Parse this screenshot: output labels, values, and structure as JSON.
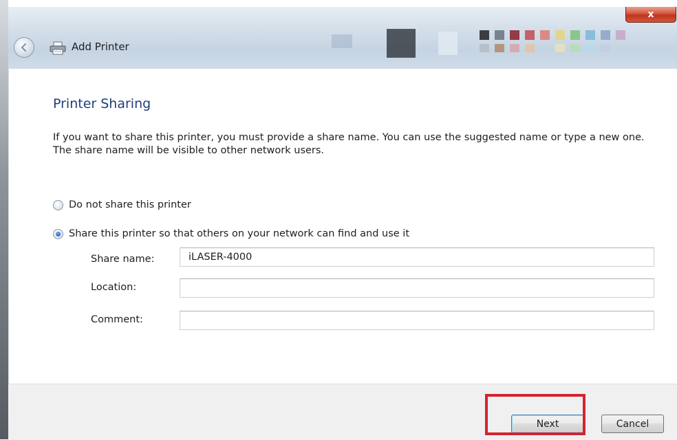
{
  "window": {
    "title": "Add Printer",
    "close_glyph": "x",
    "icons": [
      "back-arrow-icon",
      "printer-icon",
      "close-icon"
    ]
  },
  "page": {
    "heading": "Printer Sharing",
    "description": "If you want to share this printer, you must provide a share name. You can use the suggested name or type a new one. The share name will be visible to other network users."
  },
  "options": [
    {
      "label": "Do not share this printer",
      "selected": false
    },
    {
      "label": "Share this printer so that others on your network can find and use it",
      "selected": true
    }
  ],
  "fields": {
    "share_name": {
      "label": "Share name:",
      "value": "iLASER-4000"
    },
    "location": {
      "label": "Location:",
      "value": ""
    },
    "comment": {
      "label": "Comment:",
      "value": ""
    }
  },
  "buttons": {
    "next": "Next",
    "cancel": "Cancel"
  },
  "colors": {
    "heading": "#1f3d7a",
    "highlight": "#d3232e",
    "default_button_border": "#3c7fb1"
  }
}
